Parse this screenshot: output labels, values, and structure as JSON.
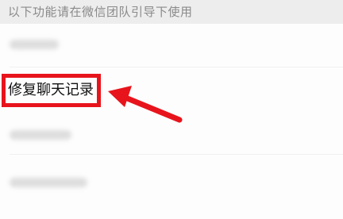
{
  "header": {
    "text": "以下功能请在微信团队引导下使用"
  },
  "list": {
    "highlighted_item": {
      "label": "修复聊天记录"
    }
  },
  "colors": {
    "annotation_red": "#e8141c",
    "header_bg": "#ededed",
    "list_bg": "#fdfdfd"
  },
  "icons": {
    "annotation": "red-arrow-icon"
  }
}
